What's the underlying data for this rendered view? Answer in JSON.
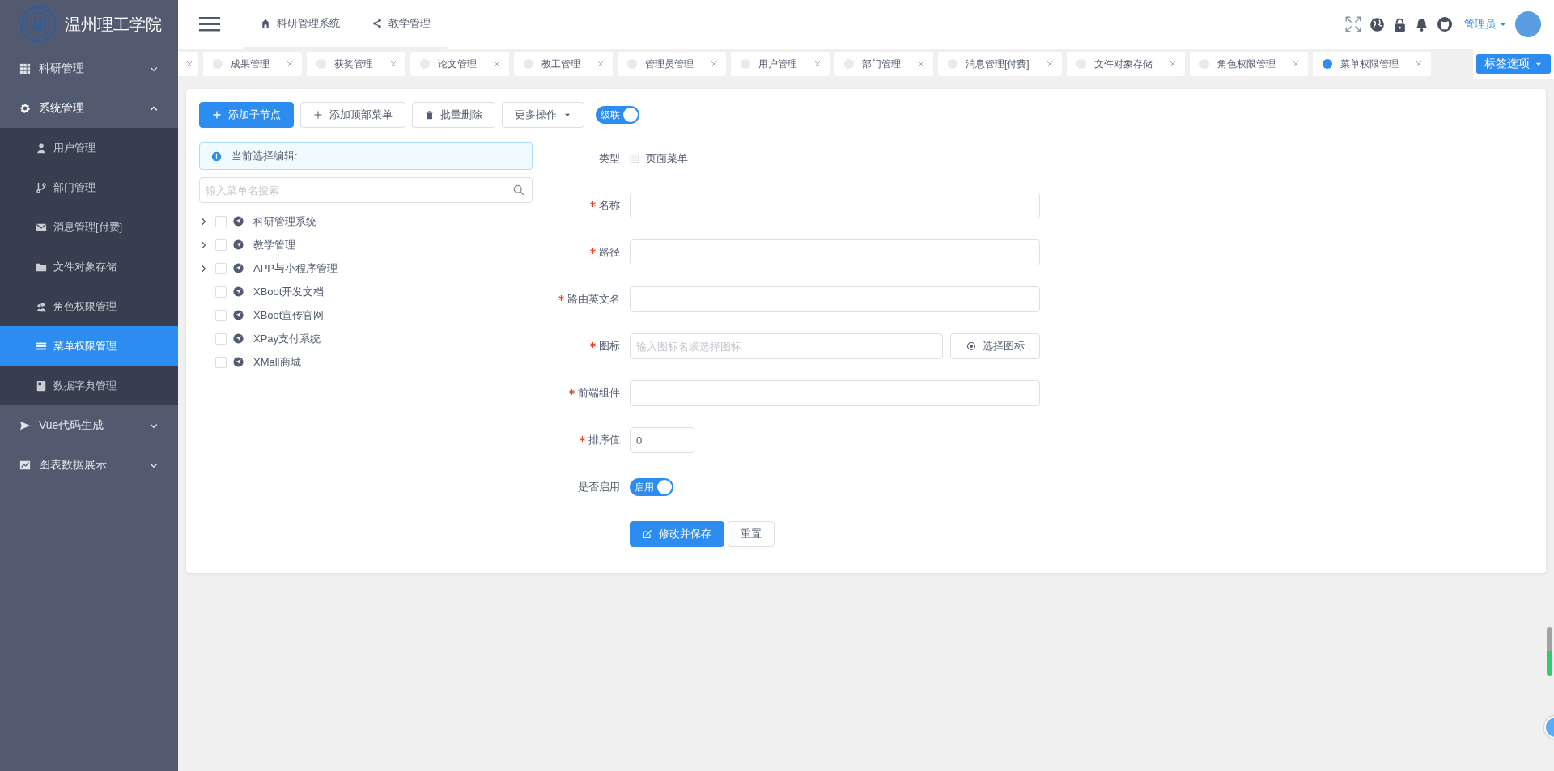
{
  "sidebar": {
    "title": "温州理工学院",
    "groups": [
      {
        "label": "科研管理",
        "expanded": false
      },
      {
        "label": "系统管理",
        "expanded": true,
        "children": [
          {
            "label": "用户管理",
            "selected": false
          },
          {
            "label": "部门管理",
            "selected": false
          },
          {
            "label": "消息管理[付费]",
            "selected": false
          },
          {
            "label": "文件对象存储",
            "selected": false
          },
          {
            "label": "角色权限管理",
            "selected": false
          },
          {
            "label": "菜单权限管理",
            "selected": true
          },
          {
            "label": "数据字典管理",
            "selected": false
          }
        ]
      },
      {
        "label": "Vue代码生成",
        "expanded": false
      },
      {
        "label": "图表数据展示",
        "expanded": false
      }
    ]
  },
  "header": {
    "menu": [
      {
        "label": "科研管理系统"
      },
      {
        "label": "教学管理"
      }
    ],
    "user": "管理员"
  },
  "tabs": {
    "items": [
      {
        "label": "成果管理",
        "selected": false
      },
      {
        "label": "获奖管理",
        "selected": false
      },
      {
        "label": "论文管理",
        "selected": false
      },
      {
        "label": "教工管理",
        "selected": false
      },
      {
        "label": "管理员管理",
        "selected": false
      },
      {
        "label": "用户管理",
        "selected": false
      },
      {
        "label": "部门管理",
        "selected": false
      },
      {
        "label": "消息管理[付费]",
        "selected": false
      },
      {
        "label": "文件对象存储",
        "selected": false
      },
      {
        "label": "角色权限管理",
        "selected": false
      },
      {
        "label": "菜单权限管理",
        "selected": true
      }
    ],
    "options_button": "标签选项"
  },
  "toolbar": {
    "buttons": [
      {
        "label": "添加子节点",
        "kind": "primary"
      },
      {
        "label": "添加顶部菜单",
        "kind": "add"
      },
      {
        "label": "批量删除",
        "kind": "delete"
      },
      {
        "label": "更多操作",
        "kind": "dropdown"
      }
    ],
    "cascade": {
      "label": "级联",
      "on": true
    }
  },
  "alert": "当前选择编辑:",
  "search": {
    "placeholder": "输入菜单名搜索"
  },
  "tree": [
    {
      "label": "科研管理系统",
      "expandable": true,
      "checked": false
    },
    {
      "label": "教学管理",
      "expandable": true,
      "checked": false
    },
    {
      "label": "APP与小程序管理",
      "expandable": true,
      "checked": false
    },
    {
      "label": "XBoot开发文档",
      "expandable": false,
      "checked": false
    },
    {
      "label": "XBoot宣传官网",
      "expandable": false,
      "checked": false
    },
    {
      "label": "XPay支付系统",
      "expandable": false,
      "checked": false
    },
    {
      "label": "XMall商城",
      "expandable": false,
      "checked": false
    }
  ],
  "form": {
    "fields": [
      {
        "label": "类型",
        "required": false,
        "kind": "type",
        "value": "页面菜单"
      },
      {
        "label": "名称",
        "required": true,
        "kind": "text"
      },
      {
        "label": "路径",
        "required": true,
        "kind": "text"
      },
      {
        "label": "路由英文名",
        "required": true,
        "kind": "text"
      },
      {
        "label": "图标",
        "required": true,
        "kind": "icon",
        "placeholder": "输入图标名或选择图标",
        "button": "选择图标"
      },
      {
        "label": "前端组件",
        "required": true,
        "kind": "text"
      },
      {
        "label": "排序值",
        "required": true,
        "kind": "number",
        "value": "0"
      },
      {
        "label": "是否启用",
        "required": false,
        "kind": "switch",
        "on": true,
        "text": "启用"
      }
    ],
    "buttons": [
      {
        "label": "修改并保存",
        "kind": "primary"
      },
      {
        "label": "重置",
        "kind": "default"
      }
    ]
  }
}
